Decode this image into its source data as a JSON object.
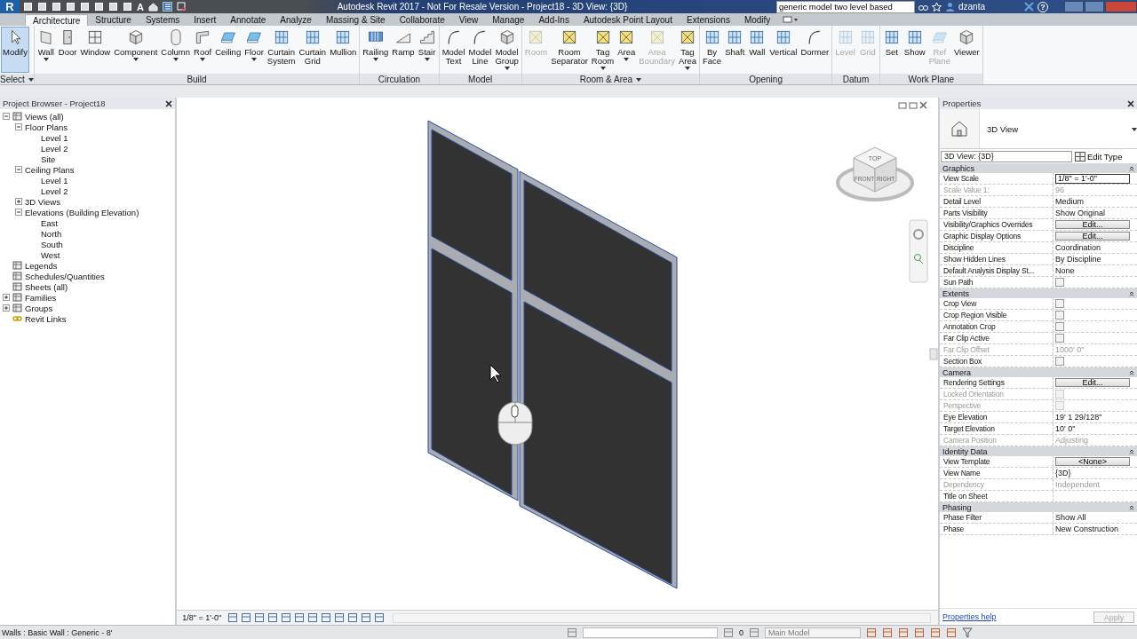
{
  "title_bar": {
    "logo": "R",
    "text_tool_glyph": "A",
    "title": "Autodesk Revit 2017 - Not For Resale Version  -  Project18 - 3D View: {3D}",
    "search": {
      "value": "generic model two level based"
    },
    "user": "dzanta",
    "help_glyph": "?"
  },
  "tabs": [
    {
      "label": "Architecture",
      "selected": true
    },
    {
      "label": "Structure",
      "selected": false
    },
    {
      "label": "Systems",
      "selected": false
    },
    {
      "label": "Insert",
      "selected": false
    },
    {
      "label": "Annotate",
      "selected": false
    },
    {
      "label": "Analyze",
      "selected": false
    },
    {
      "label": "Massing & Site",
      "selected": false
    },
    {
      "label": "Collaborate",
      "selected": false
    },
    {
      "label": "View",
      "selected": false
    },
    {
      "label": "Manage",
      "selected": false
    },
    {
      "label": "Add-Ins",
      "selected": false
    },
    {
      "label": "Autodesk Point Layout",
      "selected": false
    },
    {
      "label": "Extensions",
      "selected": false
    },
    {
      "label": "Modify",
      "selected": false
    }
  ],
  "ribbon": {
    "panels": [
      {
        "title": "Select",
        "dropdown": true,
        "buttons": [
          {
            "label": "Modify",
            "active": true,
            "disabled": false,
            "dropdown": false
          }
        ]
      },
      {
        "title": "Build",
        "dropdown": false,
        "buttons": [
          {
            "label": "Wall",
            "active": false,
            "disabled": false,
            "dropdown": true
          },
          {
            "label": "Door",
            "active": false,
            "disabled": false,
            "dropdown": false
          },
          {
            "label": "Window",
            "active": false,
            "disabled": false,
            "dropdown": false
          },
          {
            "label": "Component",
            "active": false,
            "disabled": false,
            "dropdown": true
          },
          {
            "label": "Column",
            "active": false,
            "disabled": false,
            "dropdown": true
          },
          {
            "label": "Roof",
            "active": false,
            "disabled": false,
            "dropdown": true
          },
          {
            "label": "Ceiling",
            "active": false,
            "disabled": false,
            "dropdown": false
          },
          {
            "label": "Floor",
            "active": false,
            "disabled": false,
            "dropdown": true
          },
          {
            "label": "Curtain System",
            "active": false,
            "disabled": false,
            "dropdown": false
          },
          {
            "label": "Curtain Grid",
            "active": false,
            "disabled": false,
            "dropdown": false
          },
          {
            "label": "Mullion",
            "active": false,
            "disabled": false,
            "dropdown": false
          }
        ]
      },
      {
        "title": "Circulation",
        "dropdown": false,
        "buttons": [
          {
            "label": "Railing",
            "active": false,
            "disabled": false,
            "dropdown": true
          },
          {
            "label": "Ramp",
            "active": false,
            "disabled": false,
            "dropdown": false
          },
          {
            "label": "Stair",
            "active": false,
            "disabled": false,
            "dropdown": true
          }
        ]
      },
      {
        "title": "Model",
        "dropdown": false,
        "buttons": [
          {
            "label": "Model Text",
            "active": false,
            "disabled": false,
            "dropdown": false
          },
          {
            "label": "Model Line",
            "active": false,
            "disabled": false,
            "dropdown": false
          },
          {
            "label": "Model Group",
            "active": false,
            "disabled": false,
            "dropdown": true
          }
        ]
      },
      {
        "title": "Room & Area",
        "dropdown": true,
        "buttons": [
          {
            "label": "Room",
            "active": false,
            "disabled": true,
            "dropdown": false
          },
          {
            "label": "Room Separator",
            "active": false,
            "disabled": false,
            "dropdown": false
          },
          {
            "label": "Tag Room",
            "active": false,
            "disabled": false,
            "dropdown": true
          },
          {
            "label": "Area",
            "active": false,
            "disabled": false,
            "dropdown": true
          },
          {
            "label": "Area Boundary",
            "active": false,
            "disabled": true,
            "dropdown": false
          },
          {
            "label": "Tag Area",
            "active": false,
            "disabled": false,
            "dropdown": true
          }
        ]
      },
      {
        "title": "Opening",
        "dropdown": false,
        "buttons": [
          {
            "label": "By Face",
            "active": false,
            "disabled": false,
            "dropdown": false
          },
          {
            "label": "Shaft",
            "active": false,
            "disabled": false,
            "dropdown": false
          },
          {
            "label": "Wall",
            "active": false,
            "disabled": false,
            "dropdown": false
          },
          {
            "label": "Vertical",
            "active": false,
            "disabled": false,
            "dropdown": false
          },
          {
            "label": "Dormer",
            "active": false,
            "disabled": false,
            "dropdown": false
          }
        ]
      },
      {
        "title": "Datum",
        "dropdown": false,
        "buttons": [
          {
            "label": "Level",
            "active": false,
            "disabled": true,
            "dropdown": false
          },
          {
            "label": "Grid",
            "active": false,
            "disabled": true,
            "dropdown": false
          }
        ]
      },
      {
        "title": "Work Plane",
        "dropdown": false,
        "buttons": [
          {
            "label": "Set",
            "active": false,
            "disabled": false,
            "dropdown": false
          },
          {
            "label": "Show",
            "active": false,
            "disabled": false,
            "dropdown": false
          },
          {
            "label": "Ref Plane",
            "active": false,
            "disabled": true,
            "dropdown": false
          },
          {
            "label": "Viewer",
            "active": false,
            "disabled": false,
            "dropdown": false
          }
        ]
      }
    ]
  },
  "project_browser": {
    "title": "Project Browser - Project18",
    "tree": [
      {
        "label": "Views (all)",
        "expanded": true,
        "children": [
          {
            "label": "Floor Plans",
            "expanded": true,
            "children": [
              {
                "label": "Level 1"
              },
              {
                "label": "Level 2"
              },
              {
                "label": "Site"
              }
            ]
          },
          {
            "label": "Ceiling Plans",
            "expanded": true,
            "children": [
              {
                "label": "Level 1"
              },
              {
                "label": "Level 2"
              }
            ]
          },
          {
            "label": "3D Views",
            "expanded": false
          },
          {
            "label": "Elevations (Building Elevation)",
            "expanded": true,
            "children": [
              {
                "label": "East"
              },
              {
                "label": "North"
              },
              {
                "label": "South"
              },
              {
                "label": "West"
              }
            ]
          }
        ]
      },
      {
        "label": "Legends"
      },
      {
        "label": "Schedules/Quantities"
      },
      {
        "label": "Sheets (all)"
      },
      {
        "label": "Families",
        "expanded": false
      },
      {
        "label": "Groups",
        "expanded": false
      },
      {
        "label": "Revit Links"
      }
    ]
  },
  "viewport": {
    "view_cube": {
      "top": "TOP",
      "front": "FRONT",
      "right": "RIGHT"
    },
    "view_scale": "1/8\" = 1'-0\""
  },
  "properties": {
    "title": "Properties",
    "type_name": "3D View",
    "instance": "3D View: {3D}",
    "edit_type": "Edit Type",
    "groups": [
      {
        "title": "Graphics",
        "expanded": true,
        "rows": [
          {
            "label": "View Scale",
            "kind": "input",
            "value": "1/8\" = 1'-0\"",
            "disabled": false
          },
          {
            "label": "Scale Value    1:",
            "kind": "text",
            "value": "96",
            "disabled": true
          },
          {
            "label": "Detail Level",
            "kind": "text",
            "value": "Medium",
            "disabled": false
          },
          {
            "label": "Parts Visibility",
            "kind": "text",
            "value": "Show Original",
            "disabled": false
          },
          {
            "label": "Visibility/Graphics Overrides",
            "kind": "button",
            "value": "Edit...",
            "disabled": false
          },
          {
            "label": "Graphic Display Options",
            "kind": "button",
            "value": "Edit...",
            "disabled": false
          },
          {
            "label": "Discipline",
            "kind": "text",
            "value": "Coordination",
            "disabled": false
          },
          {
            "label": "Show Hidden Lines",
            "kind": "text",
            "value": "By Discipline",
            "disabled": false
          },
          {
            "label": "Default Analysis Display St...",
            "kind": "text",
            "value": "None",
            "disabled": false
          },
          {
            "label": "Sun Path",
            "kind": "checkbox",
            "checked": false,
            "disabled": false
          }
        ]
      },
      {
        "title": "Extents",
        "expanded": true,
        "rows": [
          {
            "label": "Crop View",
            "kind": "checkbox",
            "checked": false,
            "disabled": false
          },
          {
            "label": "Crop Region Visible",
            "kind": "checkbox",
            "checked": false,
            "disabled": false
          },
          {
            "label": "Annotation Crop",
            "kind": "checkbox",
            "checked": false,
            "disabled": false
          },
          {
            "label": "Far Clip Active",
            "kind": "checkbox",
            "checked": false,
            "disabled": false
          },
          {
            "label": "Far Clip Offset",
            "kind": "text",
            "value": "1000'  0\"",
            "disabled": true
          },
          {
            "label": "Section Box",
            "kind": "checkbox",
            "checked": false,
            "disabled": false
          }
        ]
      },
      {
        "title": "Camera",
        "expanded": true,
        "rows": [
          {
            "label": "Rendering Settings",
            "kind": "button",
            "value": "Edit...",
            "disabled": false
          },
          {
            "label": "Locked Orientation",
            "kind": "checkbox",
            "checked": false,
            "disabled": true
          },
          {
            "label": "Perspective",
            "kind": "checkbox",
            "checked": false,
            "disabled": true
          },
          {
            "label": "Eye Elevation",
            "kind": "text",
            "value": "19'  1 29/128\"",
            "disabled": false
          },
          {
            "label": "Target Elevation",
            "kind": "text",
            "value": "10'  0\"",
            "disabled": false
          },
          {
            "label": "Camera Position",
            "kind": "text",
            "value": "Adjusting",
            "disabled": true
          }
        ]
      },
      {
        "title": "Identity Data",
        "expanded": true,
        "rows": [
          {
            "label": "View Template",
            "kind": "button",
            "value": "<None>",
            "disabled": false
          },
          {
            "label": "View Name",
            "kind": "text",
            "value": "{3D}",
            "disabled": false
          },
          {
            "label": "Dependency",
            "kind": "text",
            "value": "Independent",
            "disabled": true
          },
          {
            "label": "Title on Sheet",
            "kind": "text",
            "disabled": false
          }
        ]
      },
      {
        "title": "Phasing",
        "expanded": true,
        "rows": [
          {
            "label": "Phase Filter",
            "kind": "text",
            "value": "Show All",
            "disabled": false
          },
          {
            "label": "Phase",
            "kind": "text",
            "value": "New Construction",
            "disabled": false
          }
        ]
      }
    ],
    "help_link": "Properties help",
    "apply": {
      "label": "Apply",
      "disabled": true
    }
  },
  "status_bar": {
    "text": "Walls : Basic Wall : Generic - 8'",
    "count": "0",
    "design_option": "Main Model"
  }
}
